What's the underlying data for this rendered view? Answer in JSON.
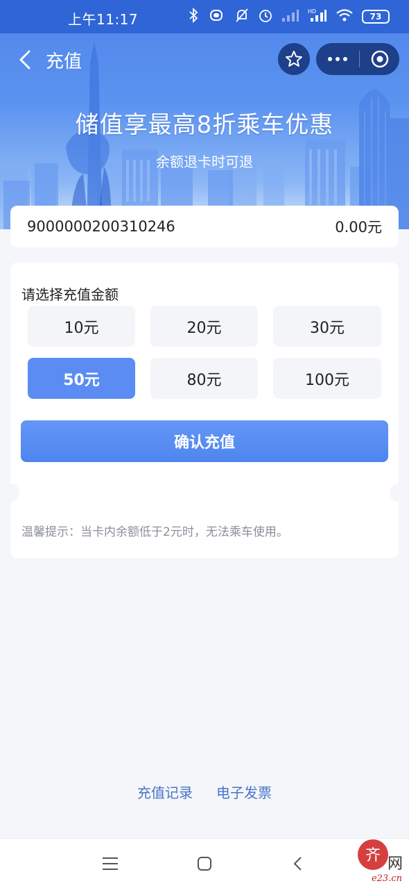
{
  "status_bar": {
    "time": "上午11:17",
    "battery": "73",
    "icons": [
      "bluetooth-icon",
      "vibrate-icon",
      "mute-bell-icon",
      "alarm-icon",
      "signal-weak-icon",
      "hd-signal-icon",
      "wifi-icon",
      "battery-icon"
    ]
  },
  "nav": {
    "title": "充值",
    "back_icon": "chevron-left-icon",
    "favorite_icon": "star-icon",
    "more_icon": "more-dots-icon",
    "close_icon": "target-circle-icon"
  },
  "banner": {
    "title": "储值享最高8折乘车优惠",
    "subtitle": "余额退卡时可退"
  },
  "card": {
    "number": "9000000200310246",
    "balance": "0.00元"
  },
  "recharge": {
    "label": "请选择充值金额",
    "amounts": [
      {
        "label": "10元",
        "selected": false
      },
      {
        "label": "20元",
        "selected": false
      },
      {
        "label": "30元",
        "selected": false
      },
      {
        "label": "50元",
        "selected": true
      },
      {
        "label": "80元",
        "selected": false
      },
      {
        "label": "100元",
        "selected": false
      }
    ],
    "confirm_label": "确认充值",
    "tip": "温馨提示：当卡内余额低于2元时，无法乘车使用。"
  },
  "footer_links": {
    "records": "充值记录",
    "invoice": "电子发票"
  },
  "system_nav": {
    "menu_icon": "menu-icon",
    "home_icon": "home-square-icon",
    "back_icon": "back-triangle-icon"
  },
  "watermark": {
    "text": "e23.cn",
    "char": "网"
  },
  "colors": {
    "primary": "#5b8cf3",
    "status_bar": "#2f65d6",
    "link": "#4a73c9",
    "tip": "#8a8f99"
  }
}
